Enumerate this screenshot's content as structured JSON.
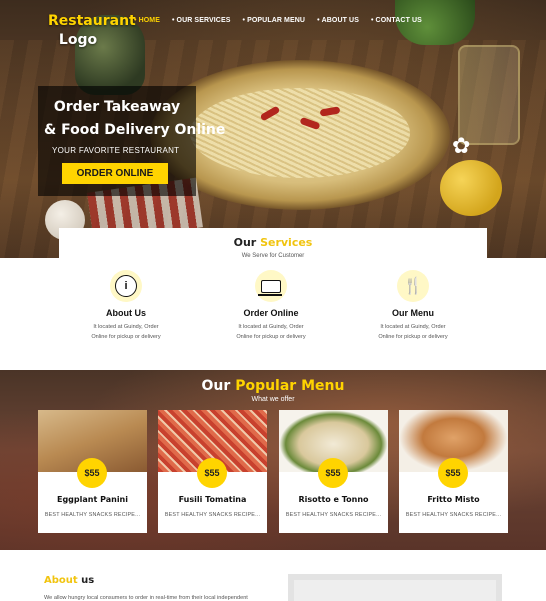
{
  "header": {
    "logo_line1": "Restaurant",
    "logo_line2": "Logo",
    "nav": [
      {
        "label": "HOME",
        "active": true
      },
      {
        "label": "OUR SERVICES",
        "active": false
      },
      {
        "label": "POPULAR MENU",
        "active": false
      },
      {
        "label": "ABOUT US",
        "active": false
      },
      {
        "label": "CONTACT US",
        "active": false
      }
    ]
  },
  "hero": {
    "title_line1": "Order Takeaway",
    "title_line2": "& Food Delivery  Online",
    "subtitle": "YOUR FAVORITE RESTAURANT",
    "cta": "ORDER ONLINE"
  },
  "services": {
    "title_part1": "Our",
    "title_part2": "Services",
    "subtitle": "We Serve for Customer",
    "items": [
      {
        "icon": "info-icon",
        "name": "About Us",
        "desc_line1": "It located at Guindy, Order",
        "desc_line2": "Online for pickup or delivery"
      },
      {
        "icon": "laptop-icon",
        "name": "Order Online",
        "desc_line1": "It located at Guindy, Order",
        "desc_line2": "Online for pickup or delivery"
      },
      {
        "icon": "cutlery-icon",
        "name": "Our Menu",
        "desc_line1": "It located at Guindy, Order",
        "desc_line2": "Online for pickup or delivery"
      }
    ]
  },
  "menu": {
    "title_part1": "Our",
    "title_part2": "Popular Menu",
    "subtitle": "What we offer",
    "items": [
      {
        "name": "Eggplant Panini",
        "price": "$55",
        "desc": "BEST HEALTHY SNACKS RECIPE..."
      },
      {
        "name": "Fusili Tomatina",
        "price": "$55",
        "desc": "BEST HEALTHY SNACKS RECIPE..."
      },
      {
        "name": "Risotto e Tonno",
        "price": "$55",
        "desc": "BEST HEALTHY SNACKS RECIPE..."
      },
      {
        "name": "Fritto Misto",
        "price": "$55",
        "desc": "BEST HEALTHY SNACKS RECIPE..."
      }
    ]
  },
  "about": {
    "title_part1": "About",
    "title_part2": "us",
    "text": "We allow hungry local consumers to order in real-time from their local independent"
  },
  "colors": {
    "accent": "#ffd400",
    "dark_overlay": "#000000",
    "text_dark": "#111111"
  }
}
